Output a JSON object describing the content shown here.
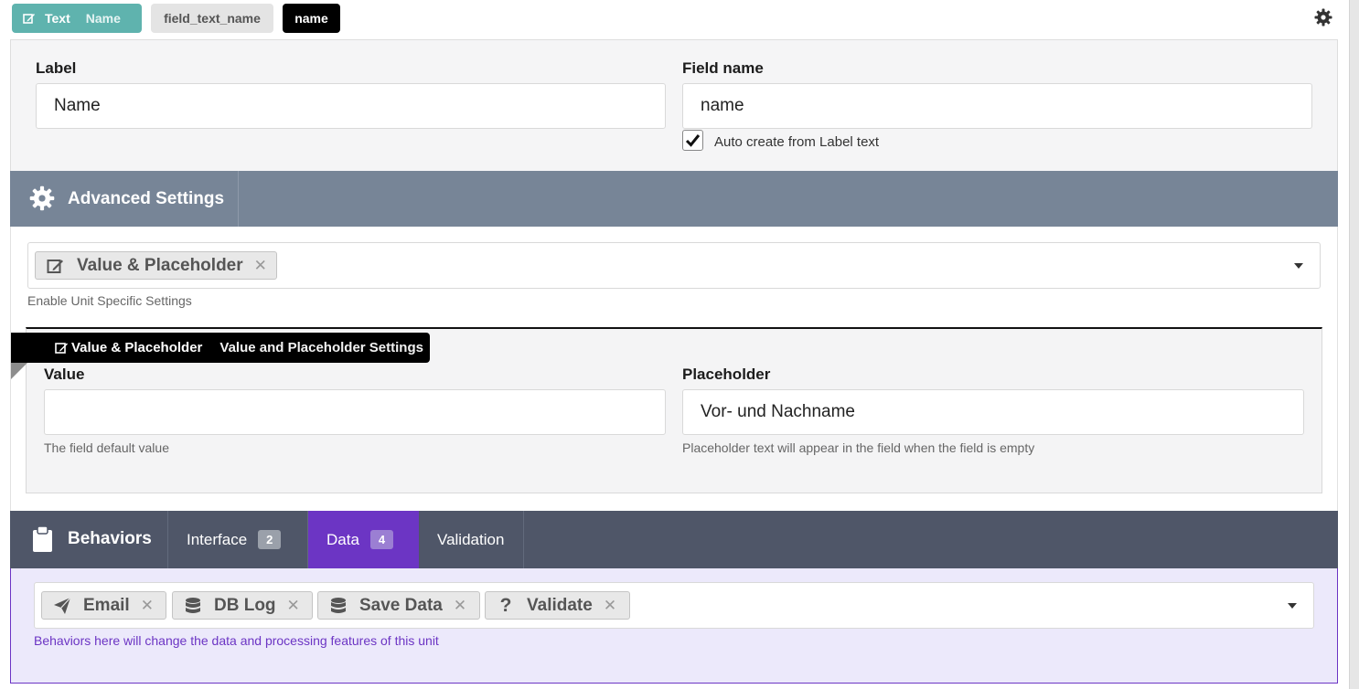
{
  "header": {
    "type_label": "Text",
    "type_name": "Name",
    "field_id": "field_text_name",
    "field_name": "name"
  },
  "basic": {
    "label_title": "Label",
    "label_value": "Name",
    "fieldname_title": "Field name",
    "fieldname_value": "name",
    "auto_create_label": "Auto create from Label text",
    "auto_create_checked": true
  },
  "advanced": {
    "title": "Advanced Settings",
    "selected": [
      {
        "label": "Value & Placeholder",
        "icon": "edit-icon"
      }
    ],
    "help": "Enable Unit Specific Settings"
  },
  "unit": {
    "tag_name": "Value & Placeholder",
    "tag_desc": "Value and Placeholder Settings",
    "value_title": "Value",
    "value_value": "",
    "value_help": "The field default value",
    "placeholder_title": "Placeholder",
    "placeholder_value": "Vor- und Nachname",
    "placeholder_help": "Placeholder text will appear in the field when the field is empty"
  },
  "behaviors": {
    "title": "Behaviors",
    "tabs": [
      {
        "label": "Interface",
        "count": "2"
      },
      {
        "label": "Data",
        "count": "4",
        "active": true
      },
      {
        "label": "Validation"
      }
    ],
    "selected": [
      {
        "label": "Email",
        "icon": "paper-plane-icon"
      },
      {
        "label": "DB Log",
        "icon": "database-icon"
      },
      {
        "label": "Save Data",
        "icon": "database-icon"
      },
      {
        "label": "Validate",
        "icon": "question-icon"
      }
    ],
    "help": "Behaviors here will change the data and processing features of this unit"
  },
  "colors": {
    "teal": "#5fb3ae",
    "slate": "#778597",
    "dark_slate": "#4f5668",
    "purple": "#6c35c4",
    "lavender": "#ece9fb"
  }
}
